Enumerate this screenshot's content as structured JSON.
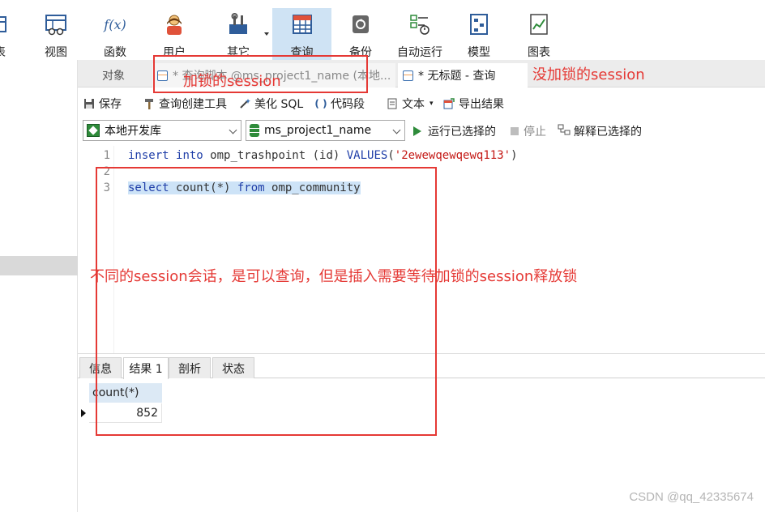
{
  "ribbon": {
    "buttons": [
      {
        "label": "表",
        "icon": "table-icon"
      },
      {
        "label": "视图",
        "icon": "view-icon"
      },
      {
        "label": "函数",
        "icon": "function-icon"
      },
      {
        "label": "用户",
        "icon": "user-icon"
      },
      {
        "label": "其它",
        "icon": "tools-icon"
      },
      {
        "label": "查询",
        "icon": "query-icon"
      },
      {
        "label": "备份",
        "icon": "backup-icon"
      },
      {
        "label": "自动运行",
        "icon": "auto-run-icon"
      },
      {
        "label": "模型",
        "icon": "model-icon"
      },
      {
        "label": "图表",
        "icon": "chart-icon"
      }
    ],
    "function_glyph": "f(x)",
    "active": "查询"
  },
  "tabs": {
    "objects": "对象",
    "locked_tab": "* 查询脚本 @ms_project1_name (本地...",
    "untitled_tab": "* 无标题 - 查询"
  },
  "actions": {
    "save": "保存",
    "query_builder": "查询创建工具",
    "beautify": "美化 SQL",
    "snippet": "代码段",
    "text": "文本",
    "export": "导出结果"
  },
  "connection": {
    "server": "本地开发库",
    "database": "ms_project1_name",
    "run_selected": "运行已选择的",
    "stop": "停止",
    "explain_selected": "解释已选择的"
  },
  "editor": {
    "line_numbers": [
      "1",
      "2",
      "3"
    ],
    "line1": {
      "kw1": "insert",
      "kw2": "into",
      "rest": " omp_trashpoint (id) ",
      "kw3": "VALUES",
      "str": "'2ewewqewqewq113'"
    },
    "line3": {
      "kw1": "select",
      "mid": " count(*) ",
      "kw2": "from",
      "rest": " omp_community"
    }
  },
  "results": {
    "tabs": [
      "信息",
      "结果 1",
      "剖析",
      "状态"
    ],
    "active_tab": "结果 1",
    "columns": [
      "count(*)"
    ],
    "rows": [
      [
        "852"
      ]
    ]
  },
  "annotations": {
    "locked_session": "加锁的session",
    "unlocked_session": "没加锁的session",
    "note": "不同的session会话，是可以查询，但是插入需要等待加锁的session释放锁",
    "color": "#e53935"
  },
  "watermark": "CSDN @qq_42335674"
}
